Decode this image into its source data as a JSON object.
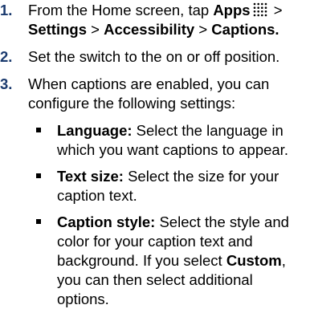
{
  "steps": [
    {
      "num": "1.",
      "prefix": "From the Home screen, tap ",
      "apps": "Apps",
      "apps_icon": "apps-grid-icon",
      "sep1": " > ",
      "settings": "Settings",
      "sep2": " > ",
      "accessibility": "Accessibility",
      "sep3": " > ",
      "captions": "Captions."
    },
    {
      "num": "2.",
      "text": "Set the switch to the on or off position."
    },
    {
      "num": "3.",
      "text": "When captions are enabled, you can configure the following settings:",
      "items": [
        {
          "label": "Language:",
          "text": " Select the language in which you want captions to appear."
        },
        {
          "label": "Text size:",
          "text": " Select the size for your caption text."
        },
        {
          "label": "Caption style:",
          "text": " Select the style and color for your caption text and background. If you select ",
          "bold2": "Custom",
          "text2": ", you can then select additional options."
        }
      ]
    }
  ],
  "colors": {
    "step_number": "#1a3a6e",
    "text": "#000000"
  }
}
